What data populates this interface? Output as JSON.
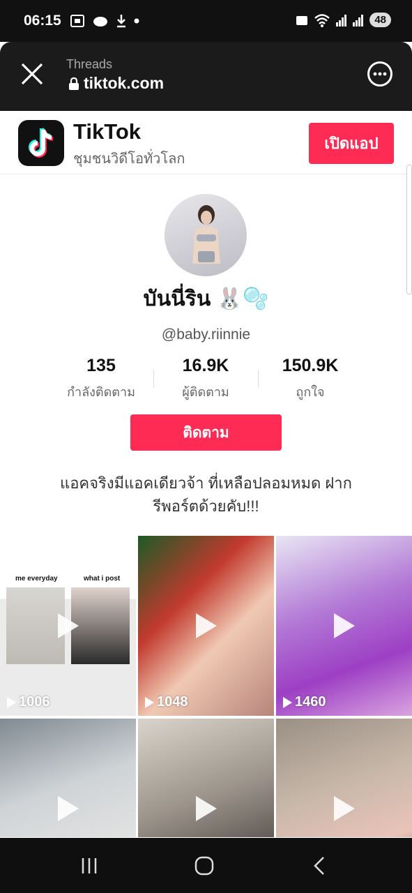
{
  "status_bar": {
    "time": "06:15",
    "battery": "48"
  },
  "browser": {
    "source": "Threads",
    "url": "tiktok.com"
  },
  "app_banner": {
    "name": "TikTok",
    "subtitle": "ชุมชนวิดีโอทั่วโลก",
    "open_label": "เปิดแอป"
  },
  "profile": {
    "nickname": "บันนี่ริน 🐰🫧",
    "username": "@baby.riinnie",
    "stats": [
      {
        "value": "135",
        "label": "กำลังติดตาม"
      },
      {
        "value": "16.9K",
        "label": "ผู้ติดตาม"
      },
      {
        "value": "150.9K",
        "label": "ถูกใจ"
      }
    ],
    "follow_label": "ติดตาม",
    "bio_line1": "แอคจริงมีแอคเดียวจ้า ที่เหลือปลอมหมด ฝาก",
    "bio_line2": "รีพอร์ตด้วยคับ!!!"
  },
  "videos": [
    {
      "views": "1006",
      "caption_left": "me everyday",
      "caption_right": "what i post"
    },
    {
      "views": "1048"
    },
    {
      "views": "1460"
    },
    {
      "views": ""
    },
    {
      "views": ""
    },
    {
      "views": ""
    }
  ],
  "icons": [
    "close-icon",
    "lock-icon",
    "more-icon",
    "tiktok-logo-icon",
    "play-icon",
    "recents-icon",
    "home-icon",
    "back-icon"
  ],
  "colors": {
    "accent": "#fe2c55",
    "status_bar_bg": "#111111",
    "browser_bar_bg": "#1b1b1b"
  }
}
